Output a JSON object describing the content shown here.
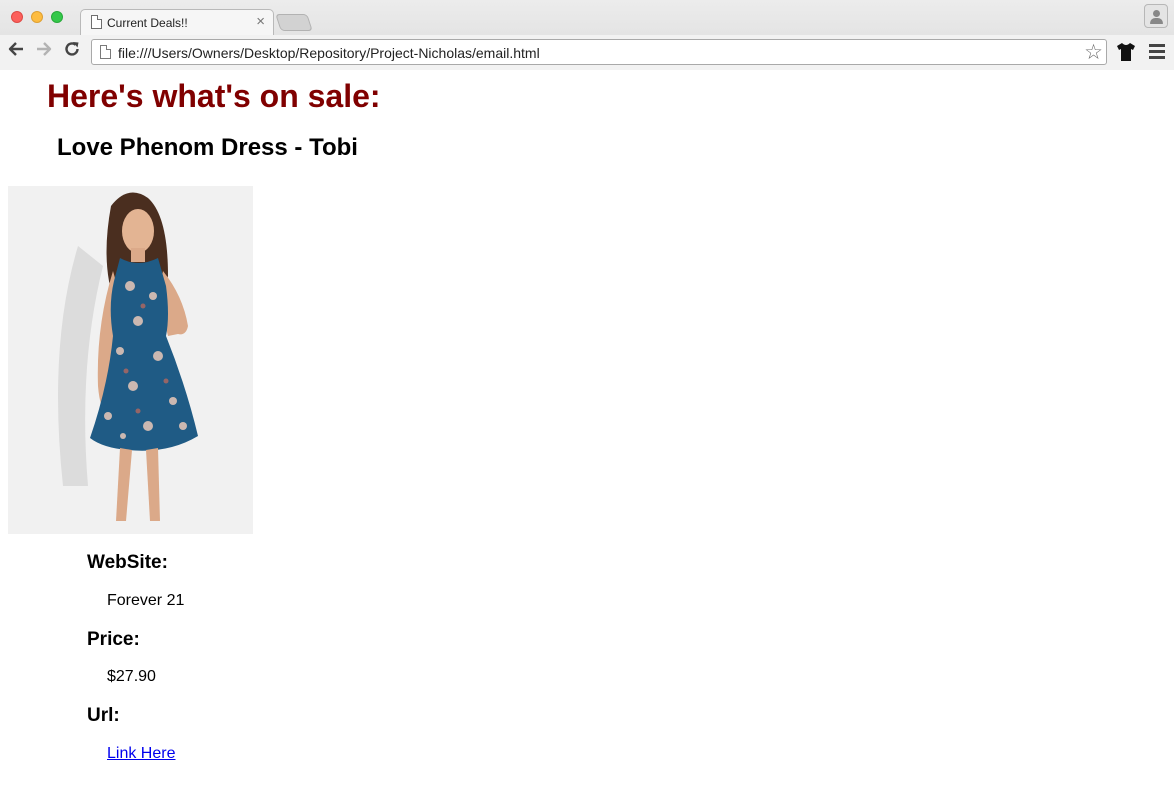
{
  "browser": {
    "tab_title": "Current Deals!!",
    "tab_close": "×",
    "url": "file:///Users/Owners/Desktop/Repository/Project-Nicholas/email.html",
    "icons": {
      "back": "arrow-left-icon",
      "forward": "arrow-right-icon",
      "reload": "reload-icon",
      "bookmark": "star-icon",
      "extension": "tshirt-icon",
      "menu": "hamburger-menu-icon",
      "profile": "person-icon"
    }
  },
  "page": {
    "heading": "Here's what's on sale:",
    "heading_color": "#800000",
    "product": {
      "name": "Love Phenom Dress - Tobi",
      "website_label": "WebSite:",
      "website": "Forever 21",
      "price_label": "Price:",
      "price": "$27.90",
      "url_label": "Url:",
      "link_text": "Link Here"
    }
  }
}
